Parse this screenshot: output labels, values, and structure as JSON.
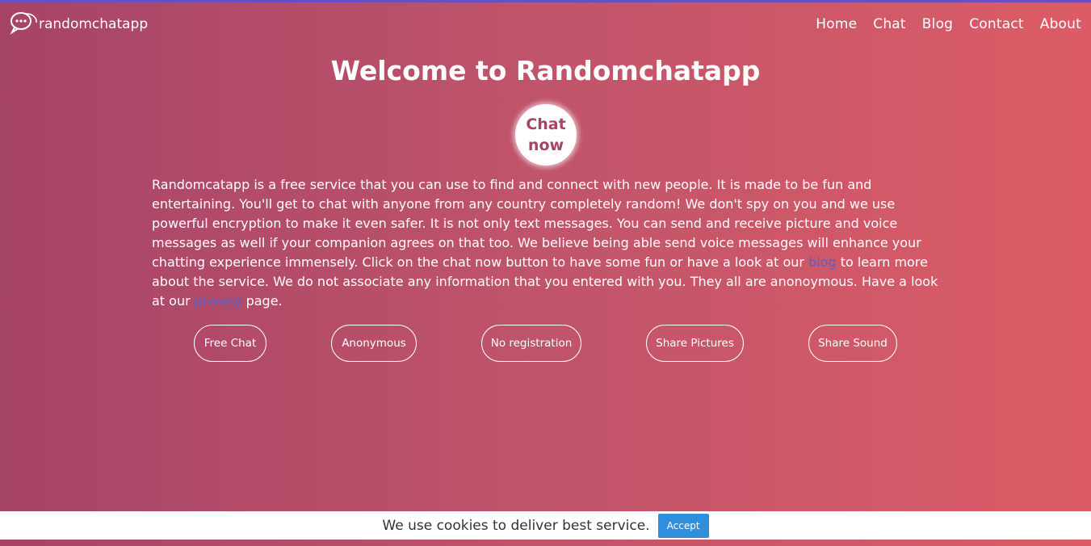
{
  "colors": {
    "gradient_start": "#a64467",
    "gradient_end": "#dc5c66",
    "top_border": "#6a4fc4",
    "link": "#4a63d8",
    "accept_button": "#2f8fdd"
  },
  "brand": {
    "logo_icon": "chat-bubbles-logo-icon",
    "name": "randomchatapp"
  },
  "nav": {
    "items": [
      {
        "label": "Home"
      },
      {
        "label": "Chat"
      },
      {
        "label": "Blog"
      },
      {
        "label": "Contact"
      },
      {
        "label": "About"
      }
    ]
  },
  "main": {
    "title": "Welcome to Randomchatapp",
    "chat_now_label": "Chat now",
    "intro_part1": "Randomcatapp is a free service that you can use to find and connect with new people. It is made to be fun and entertaining. You'll get to chat with anyone from any country completely random! We don't spy on you and we use powerful encryption to make it even safer. It is not only text messages. You can send and receive picture and voice messages as well if your companion agrees on that too. We believe being able send voice messages will enhance your chatting experience immensely. Click on the chat now button to have some fun or have a look at our ",
    "blog_link": "blog",
    "intro_part2": " to learn more about the service. We do not associate any information that you entered with you. They all are anonoymous. Have a look at our ",
    "privacy_link": "privacy",
    "intro_part3": " page."
  },
  "features": [
    {
      "label": "Free Chat"
    },
    {
      "label": "Anonymous"
    },
    {
      "label": "No registration"
    },
    {
      "label": "Share Pictures"
    },
    {
      "label": "Share Sound"
    }
  ],
  "cookie": {
    "message": "We use cookies to deliver best service.",
    "accept_label": "Accept"
  }
}
